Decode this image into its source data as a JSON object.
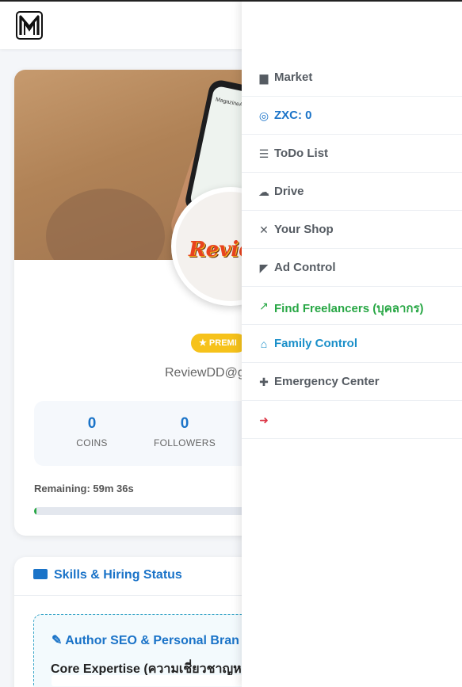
{
  "header": {
    "logo_letter": "M"
  },
  "profile": {
    "cover_phone_title": "MagazineASP",
    "avatar_brand_text": "Review",
    "premium_badge": "PREMI",
    "email": "ReviewDD@g",
    "stats": [
      {
        "value": "0",
        "label": "COINS"
      },
      {
        "value": "0",
        "label": "FOLLOWERS"
      }
    ],
    "remaining_text": "Remaining: 59m 36s",
    "progress_fraction": 0.01
  },
  "skills": {
    "title": "Skills & Hiring Status",
    "subsection_title": "Author SEO & Personal Bran",
    "core_expertise": "Core Expertise (ความเชี่ยวชาญห"
  },
  "menu": {
    "items": [
      {
        "label": "Market",
        "icon": "store-icon",
        "glyph": "▆",
        "color": "gray"
      },
      {
        "label": "ZXC: 0",
        "icon": "coins-icon",
        "glyph": "◎",
        "color": "blue"
      },
      {
        "label": "ToDo List",
        "icon": "tasks-icon",
        "glyph": "☰",
        "color": "gray"
      },
      {
        "label": "Drive",
        "icon": "cloud-icon",
        "glyph": "☁",
        "color": "gray"
      },
      {
        "label": "Your Shop",
        "icon": "tools-icon",
        "glyph": "✕",
        "color": "gray"
      },
      {
        "label": "Ad Control",
        "icon": "bullhorn-icon",
        "glyph": "◤",
        "color": "gray"
      },
      {
        "label": "Find Freelancers (บุคลากร)",
        "icon": "chart-line-icon",
        "glyph": "↗",
        "color": "green"
      },
      {
        "label": "Family Control",
        "icon": "house-user-icon",
        "glyph": "⌂",
        "color": "teal"
      },
      {
        "label": "Emergency Center",
        "icon": "medkit-icon",
        "glyph": "✚",
        "color": "gray"
      },
      {
        "label": "",
        "icon": "sign-out-icon",
        "glyph": "➜",
        "color": "red"
      }
    ]
  }
}
